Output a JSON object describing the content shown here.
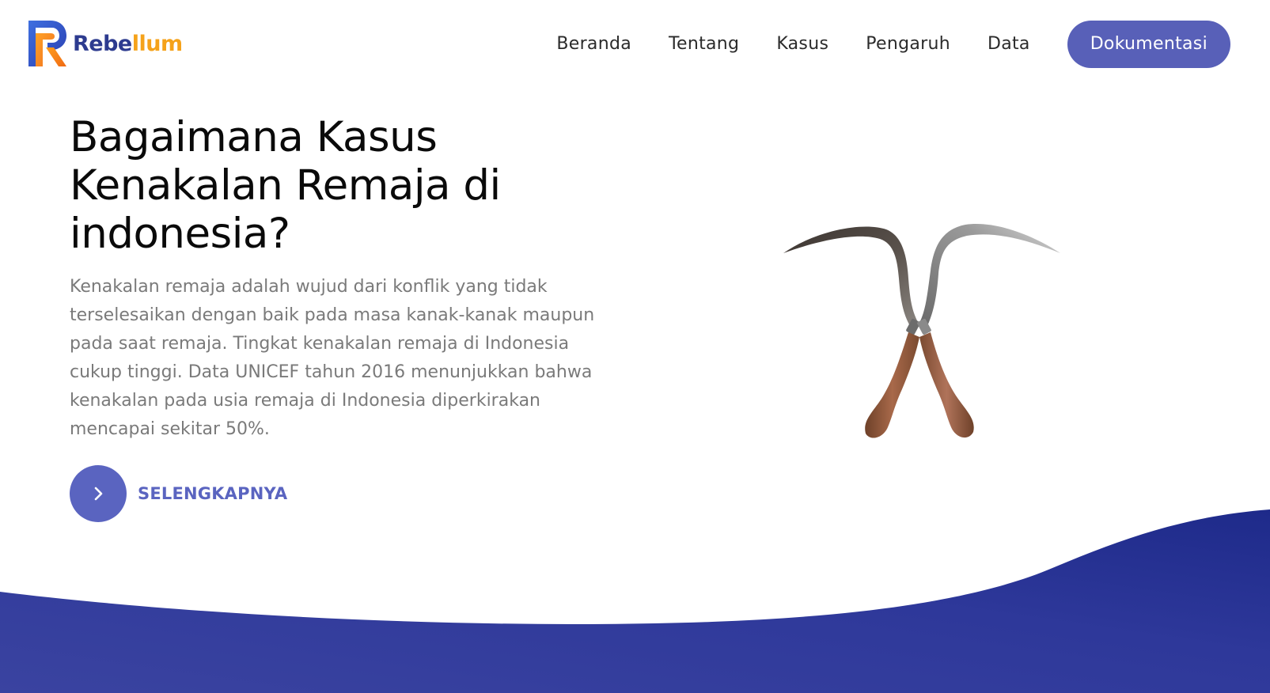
{
  "brand": {
    "name_part1": "Rebe",
    "name_part2": "llum"
  },
  "nav": {
    "items": [
      {
        "label": "Beranda"
      },
      {
        "label": "Tentang"
      },
      {
        "label": "Kasus"
      },
      {
        "label": "Pengaruh"
      },
      {
        "label": "Data"
      }
    ],
    "cta_label": "Dokumentasi"
  },
  "hero": {
    "title": "Bagaimana Kasus Kenakalan Remaja di indonesia?",
    "description": "Kenakalan remaja adalah wujud dari konflik yang tidak terselesaikan dengan baik pada masa kanak-kanak maupun pada saat remaja. Tingkat kenakalan remaja di Indonesia cukup tinggi. Data UNICEF tahun 2016 menunjukkan bahwa kenakalan pada usia remaja di Indonesia diperkirakan mencapai sekitar 50%.",
    "more_label": "SELENGKAPNYA",
    "illustration": "crossed-sickles"
  },
  "icons": {
    "logo": "rebellum-logo-icon",
    "cta_arrow": "chevron-right-icon"
  },
  "colors": {
    "accent": "#5860b8",
    "brand_dark": "#2d3b8f",
    "brand_orange": "#f5a21a",
    "wave_dark": "#1e2a8a",
    "wave_light": "#3a43a0",
    "text_dark": "#0a0a0a",
    "text_muted": "#7a7a7a"
  }
}
